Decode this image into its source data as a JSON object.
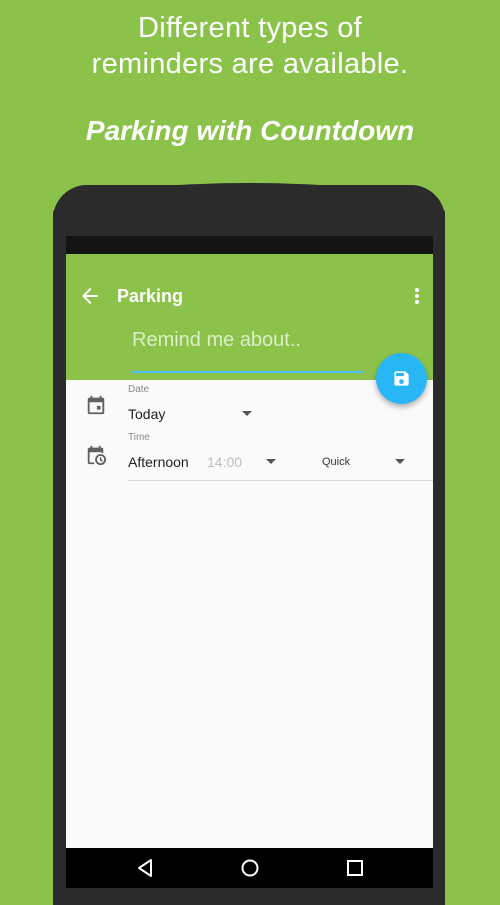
{
  "promo": {
    "headline_line1": "Different types of",
    "headline_line2": "reminders are available.",
    "subheadline": "Parking with Countdown"
  },
  "app_bar": {
    "title": "Parking",
    "back_icon": "arrow-back-icon",
    "menu_icon": "more-vert-icon"
  },
  "reminder": {
    "placeholder": "Remind me about..",
    "value": ""
  },
  "fab": {
    "icon": "save-icon",
    "color": "#29b6f6"
  },
  "date": {
    "label": "Date",
    "value": "Today",
    "icon": "calendar-icon"
  },
  "time": {
    "label": "Time",
    "period": "Afternoon",
    "clock": "14:00",
    "mode": "Quick",
    "icon": "calendar-clock-icon"
  },
  "navigation": {
    "back": "nav-back-icon",
    "home": "nav-home-icon",
    "recents": "nav-recents-icon"
  },
  "colors": {
    "accent_green": "#8bc34a",
    "fab_blue": "#29b6f6",
    "input_underline": "#4fc3f7"
  }
}
